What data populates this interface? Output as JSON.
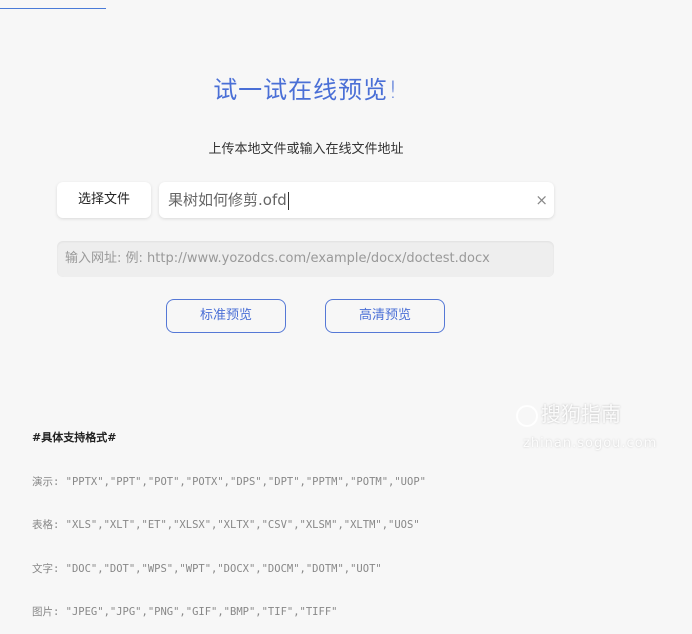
{
  "headline": "试一试在线预览!",
  "subline": "上传本地文件或输入在线文件地址",
  "upload": {
    "choose_label": "选择文件",
    "file_value": "果树如何修剪.ofd",
    "clear_icon": "×"
  },
  "url": {
    "placeholder": "输入网址: 例: http://www.yozodcs.com/example/docx/doctest.docx"
  },
  "buttons": {
    "standard": "标准预览",
    "hd": "高清预览"
  },
  "formats": {
    "title": "#具体支持格式#",
    "lines": [
      "演示: \"PPTX\",\"PPT\",\"POT\",\"POTX\",\"DPS\",\"DPT\",\"PPTM\",\"POTM\",\"UOP\"",
      "表格: \"XLS\",\"XLT\",\"ET\",\"XLSX\",\"XLTX\",\"CSV\",\"XLSM\",\"XLTM\",\"UOS\"",
      "文字: \"DOC\",\"DOT\",\"WPS\",\"WPT\",\"DOCX\",\"DOCM\",\"DOTM\",\"UOT\"",
      "图片: \"JPEG\",\"JPG\",\"PNG\",\"GIF\",\"BMP\",\"TIF\",\"TIFF\""
    ]
  },
  "watermark": {
    "brand": "搜狗指南",
    "url": "zhinan.sogou.com"
  }
}
